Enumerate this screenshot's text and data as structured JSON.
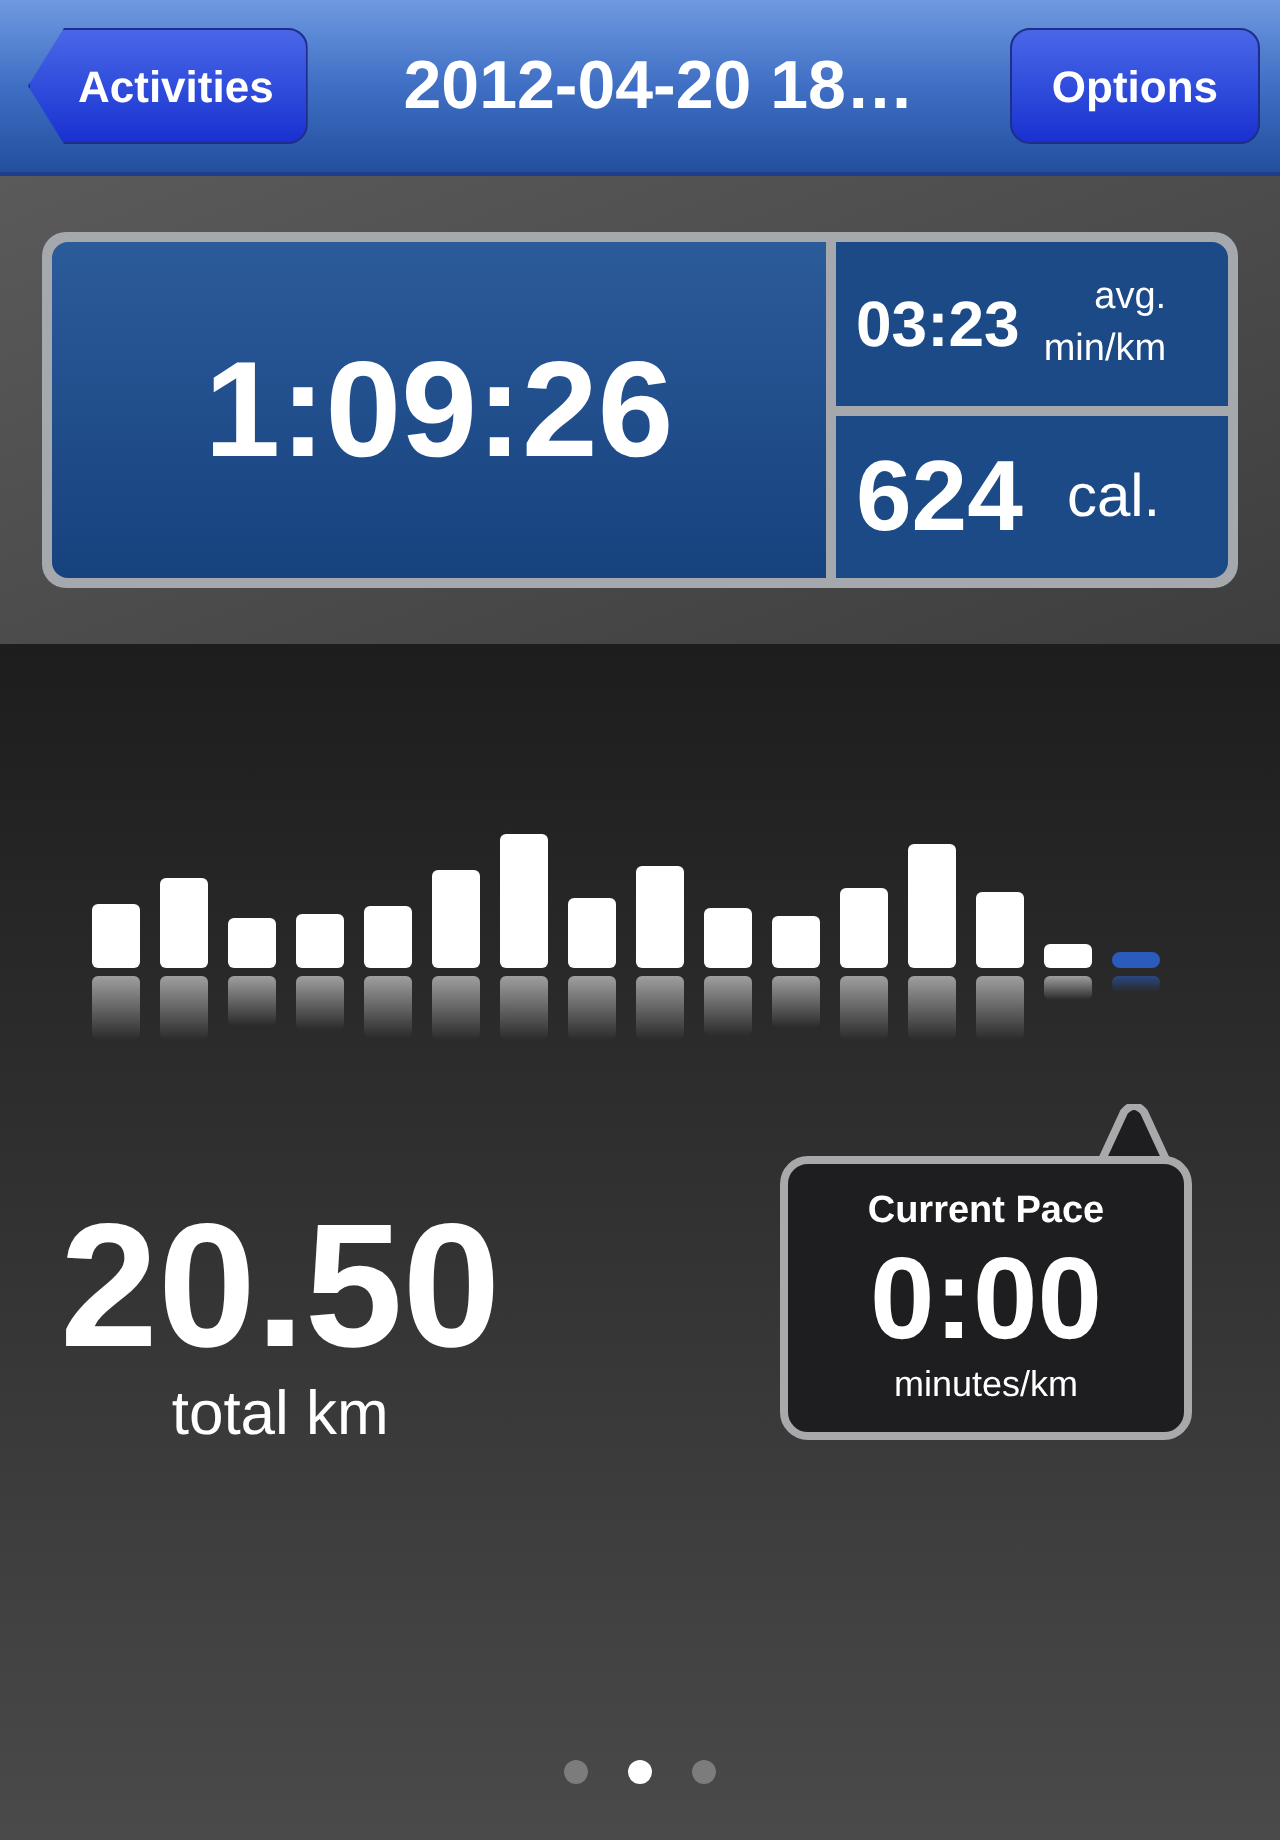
{
  "nav_bar": {
    "back_button": "Activities",
    "title": "2012-04-20 18…",
    "options_button": "Options"
  },
  "summary": {
    "duration": "1:09:26",
    "pace": {
      "value": "03:23",
      "unit_line_1": "avg.",
      "unit_line_2": "min/km"
    },
    "calories": {
      "value": "624",
      "unit": "cal."
    }
  },
  "distance": {
    "value": "20.50",
    "unit": "total km"
  },
  "current_pace": {
    "title": "Current Pace",
    "value": "0:00",
    "unit": "minutes/km"
  },
  "page_dots": [
    {
      "selected": false
    },
    {
      "selected": true
    },
    {
      "selected": false
    }
  ]
}
